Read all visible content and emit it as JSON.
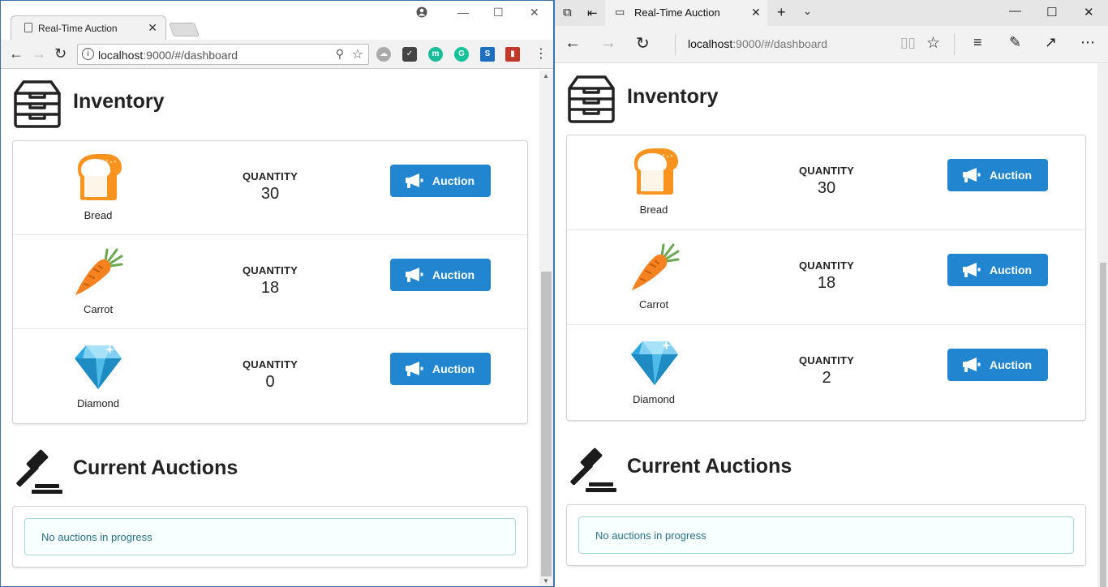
{
  "chrome": {
    "tab_title": "Real-Time Auction",
    "url_host": "localhost",
    "url_path": ":9000/#/dashboard"
  },
  "edge": {
    "tab_title": "Real-Time Auction",
    "url_host": "localhost",
    "url_path": ":9000/#/dashboard"
  },
  "inventory_title": "Inventory",
  "current_auctions_title": "Current Auctions",
  "quantity_label": "QUANTITY",
  "auction_button_label": "Auction",
  "no_auctions_message": "No auctions in progress",
  "chrome_items": [
    {
      "name": "Bread",
      "quantity": "30",
      "icon": "bread-icon"
    },
    {
      "name": "Carrot",
      "quantity": "18",
      "icon": "carrot-icon"
    },
    {
      "name": "Diamond",
      "quantity": "0",
      "icon": "diamond-icon"
    }
  ],
  "edge_items": [
    {
      "name": "Bread",
      "quantity": "30",
      "icon": "bread-icon"
    },
    {
      "name": "Carrot",
      "quantity": "18",
      "icon": "carrot-icon"
    },
    {
      "name": "Diamond",
      "quantity": "2",
      "icon": "diamond-icon"
    }
  ],
  "colors": {
    "button": "#2185d0",
    "info_bg": "#f8ffff",
    "info_border": "#a9d5de",
    "info_text": "#276f86"
  }
}
